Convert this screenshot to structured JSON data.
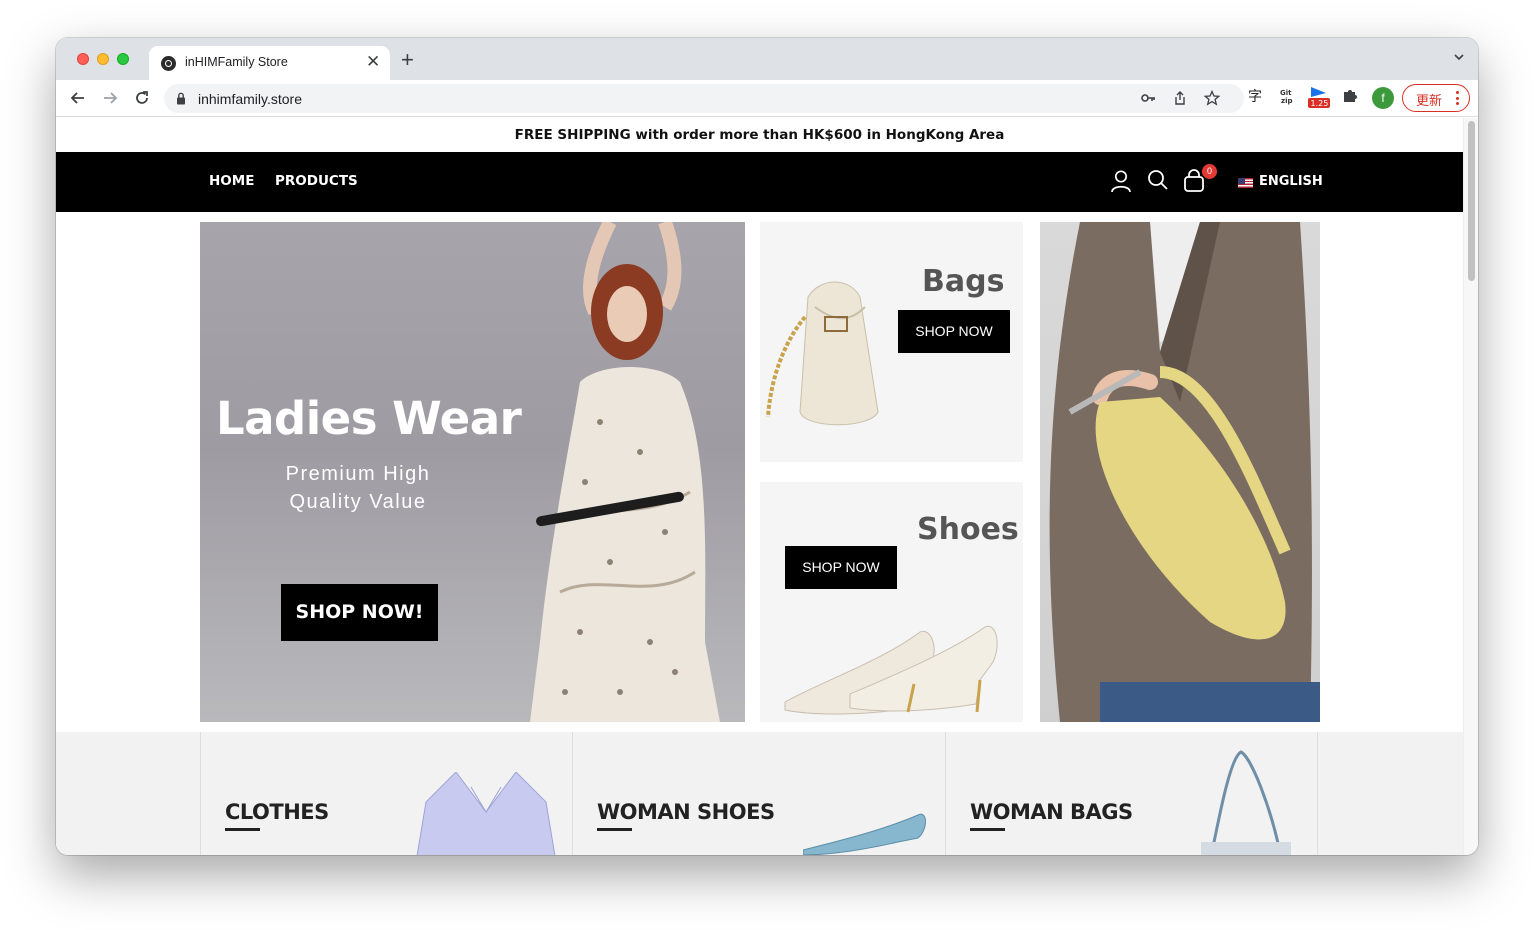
{
  "browser": {
    "tab_title": "inHIMFamily Store",
    "tab_close": "✕",
    "new_tab": "+",
    "url": "inhimfamily.store",
    "extension_badge": "1.25",
    "profile_initial": "f",
    "update_label": "更新"
  },
  "site": {
    "announcement": "FREE SHIPPING with order more than HK$600 in HongKong Area",
    "nav": {
      "home": "HOME",
      "products": "PRODUCTS",
      "cart_count": "0",
      "language": "ENGLISH"
    },
    "hero": {
      "title": "Ladies Wear",
      "subtitle": "Premium High Quality Value",
      "button": "SHOP NOW!"
    },
    "bags_tile": {
      "title": "Bags",
      "button": "SHOP NOW"
    },
    "shoes_tile": {
      "title": "Shoes",
      "button": "SHOP NOW"
    },
    "categories": [
      {
        "label": "CLOTHES"
      },
      {
        "label": "WOMAN SHOES"
      },
      {
        "label": "WOMAN BAGS"
      }
    ]
  },
  "colors": {
    "navbar": "#000000",
    "accent_red": "#e53935",
    "update_red": "#d93025"
  },
  "icons": [
    "back-icon",
    "forward-icon",
    "reload-icon",
    "lock-icon",
    "key-icon",
    "share-icon",
    "star-icon",
    "translate-icon",
    "gitzip-icon",
    "extension-flag-icon",
    "puzzle-icon",
    "user-icon",
    "search-icon",
    "cart-icon",
    "flag-us-icon"
  ]
}
